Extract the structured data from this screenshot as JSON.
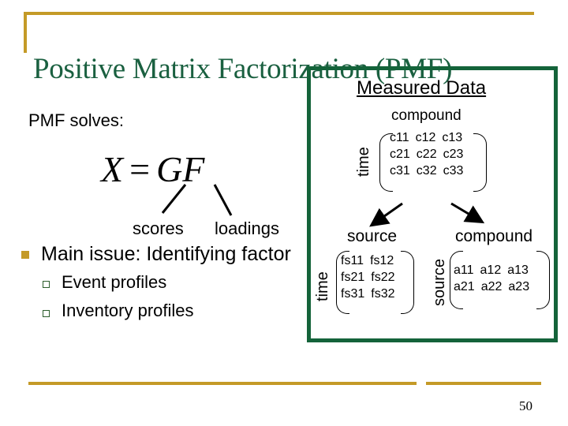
{
  "slide": {
    "title": "Positive Matrix Factorization (PMF)",
    "page_number": "50",
    "accent_color": "#c49a27",
    "title_color": "#1a6040",
    "box_color": "#14633a"
  },
  "left": {
    "intro": "PMF solves:",
    "equation": {
      "lhs": "X",
      "equals": "=",
      "rhs": "GF"
    },
    "scores_label": "scores",
    "loadings_label": "loadings",
    "main_bullet": "Main issue: Identifying factor",
    "sub_bullets": [
      "Event profiles",
      "Inventory profiles"
    ]
  },
  "measured_data": {
    "title": "Measured Data",
    "column_label": "compound",
    "row_label": "time",
    "matrix": [
      [
        "c11",
        "c12",
        "c13"
      ],
      [
        "c21",
        "c22",
        "c23"
      ],
      [
        "c31",
        "c32",
        "c33"
      ]
    ]
  },
  "source_matrix": {
    "column_label": "source",
    "row_label": "time",
    "matrix": [
      [
        "fs11",
        "fs12"
      ],
      [
        "fs21",
        "fs22"
      ],
      [
        "fs31",
        "fs32"
      ]
    ]
  },
  "profile_matrix": {
    "column_label": "compound",
    "row_label": "source",
    "matrix": [
      [
        "a11",
        "a12",
        "a13"
      ],
      [
        "a21",
        "a22",
        "a23"
      ]
    ]
  }
}
